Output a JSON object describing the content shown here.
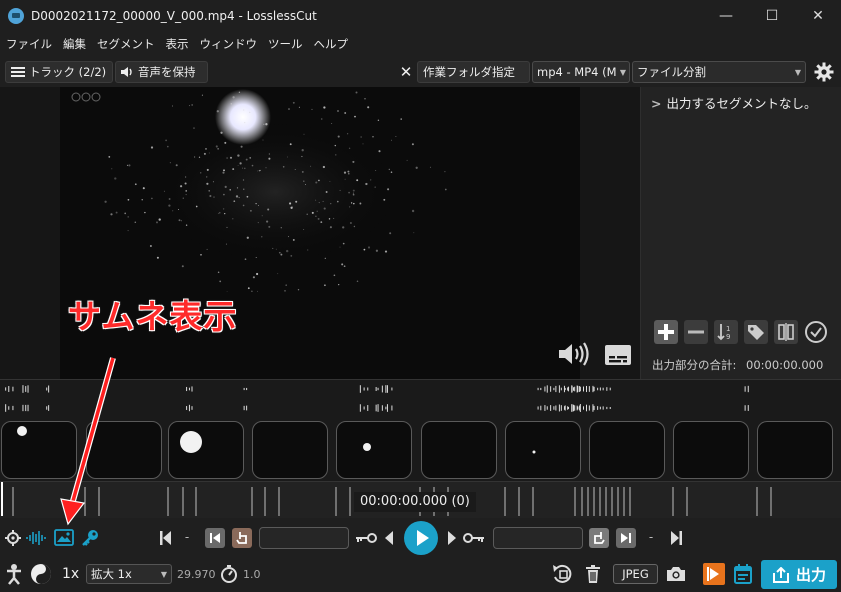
{
  "window": {
    "title": "D0002021172_00000_V_000.mp4 - LosslessCut",
    "minimize_glyph": "—",
    "maximize_glyph": "☐",
    "close_glyph": "✕"
  },
  "menu": [
    "ファイル",
    "編集",
    "セグメント",
    "表示",
    "ウィンドウ",
    "ツール",
    "ヘルプ"
  ],
  "toolbar": {
    "tracks_label": "トラック (2/2)",
    "keep_audio_label": "音声を保持",
    "workdir_label": "作業フォルダ指定",
    "format_select": "mp4 - MP4 (M",
    "mode_select": "ファイル分割"
  },
  "right_panel": {
    "no_segments_text": "出力するセグメントなし。",
    "total_label": "出力部分の合計:",
    "total_value": "00:00:00.000"
  },
  "timeline": {
    "current_time": "00:00:00.000 (0)"
  },
  "annotation": {
    "text": "サムネ表示",
    "color": "#ff2a2a"
  },
  "controls": {
    "dash_left": "-",
    "dash_right": "-",
    "start_time_value": "",
    "end_time_value": ""
  },
  "bottombar": {
    "speed_label": "1x",
    "zoom_select": "拡大 1x",
    "fps_value": "29.970",
    "playback_rate": "1.0",
    "capture_format": "JPEG",
    "export_label": "出力"
  },
  "colors": {
    "accent": "#1ba1c9",
    "orange": "#e8731c",
    "background": "#1f1f1f"
  }
}
